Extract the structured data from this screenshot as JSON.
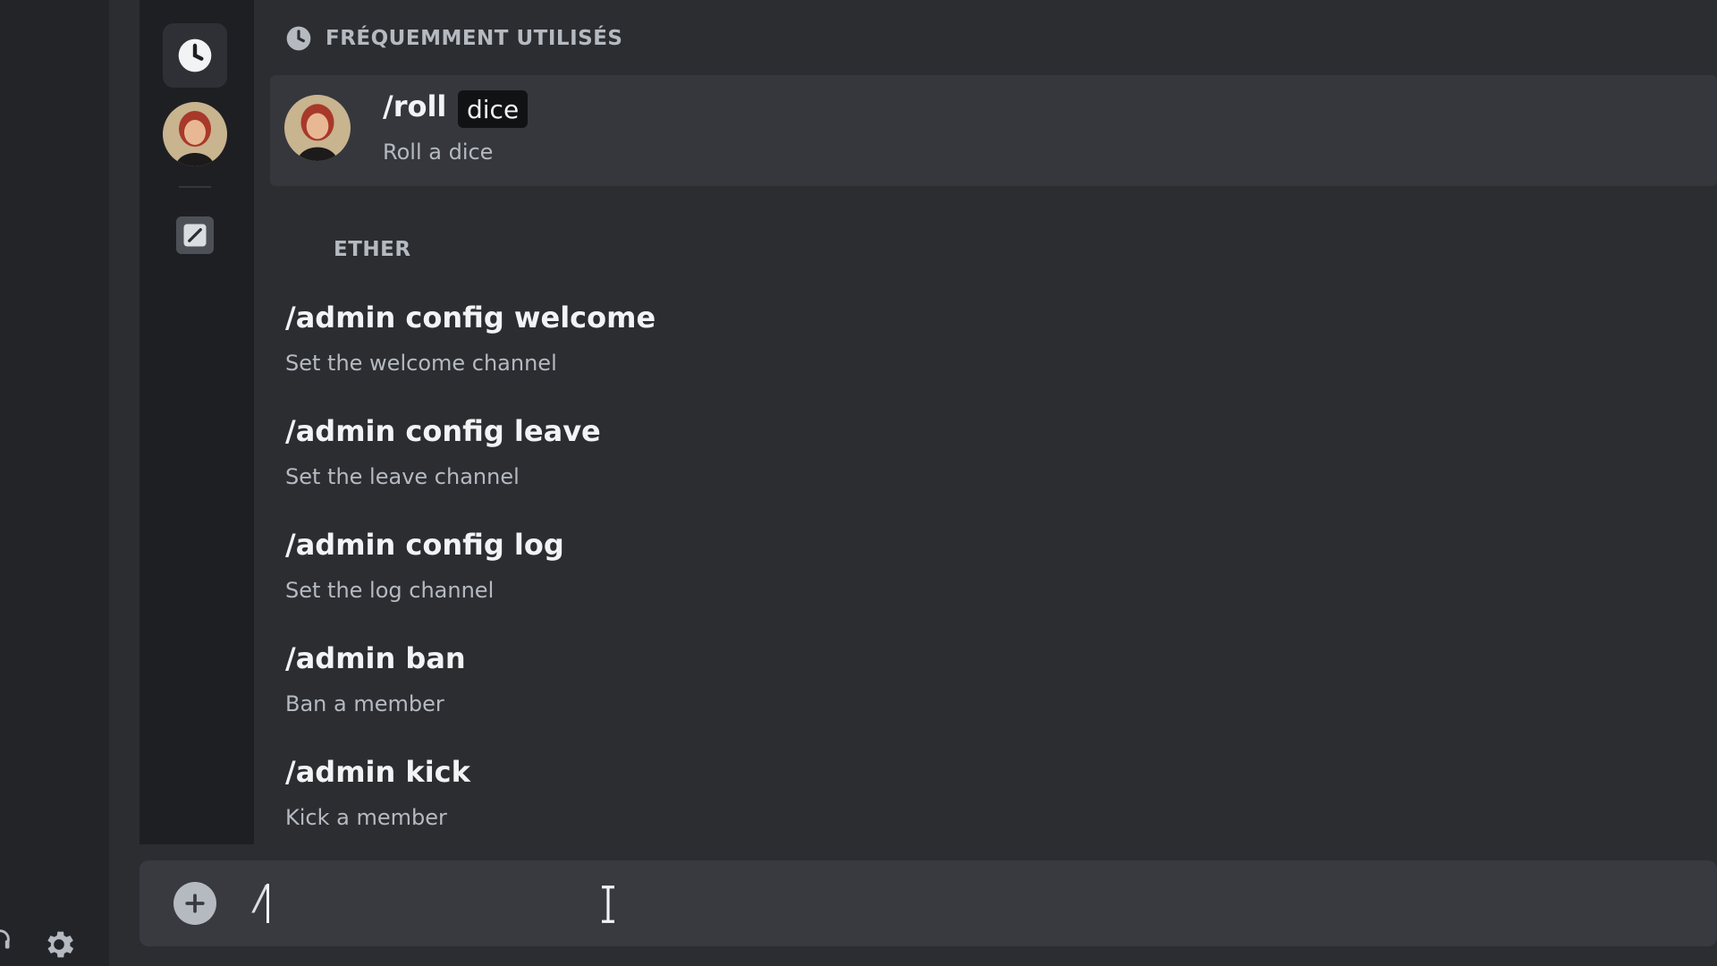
{
  "frequent_section": {
    "title": "FRÉQUEMMENT UTILISÉS"
  },
  "roll_command": {
    "name": "/roll",
    "param": "dice",
    "description": "Roll a dice"
  },
  "ether_section": {
    "title": "ETHER"
  },
  "commands": [
    {
      "name": "/admin config welcome",
      "description": "Set the welcome channel"
    },
    {
      "name": "/admin config leave",
      "description": "Set the leave channel"
    },
    {
      "name": "/admin config log",
      "description": "Set the log channel"
    },
    {
      "name": "/admin ban",
      "description": "Ban a member"
    },
    {
      "name": "/admin kick",
      "description": "Kick a member"
    }
  ],
  "message_input": {
    "value": "/"
  },
  "icons": {
    "rail_recent": "clock-icon",
    "rail_bot": "bot-avatar",
    "rail_ether": "pencil-icon",
    "add": "plus-circle-icon",
    "settings": "gear-icon",
    "cursor": "text-cursor-icon"
  },
  "colors": {
    "background": "#2b2d31",
    "rail": "#1e1f22",
    "selected_row": "#35373c",
    "input": "#383a40"
  }
}
